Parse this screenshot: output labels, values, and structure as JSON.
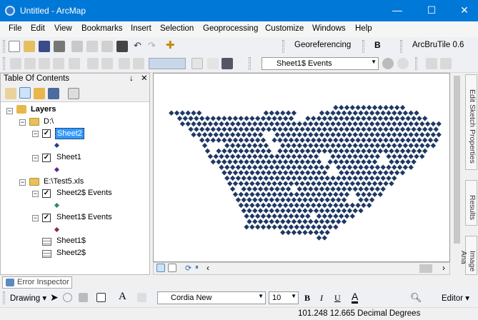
{
  "window": {
    "title": "Untitled - ArcMap",
    "minimize": "—",
    "maximize": "☐",
    "close": "✕"
  },
  "menu": [
    "File",
    "Edit",
    "View",
    "Bookmarks",
    "Insert",
    "Selection",
    "Geoprocessing",
    "Customize",
    "Windows",
    "Help"
  ],
  "toolbar": {
    "georef_label": "Georeferencing",
    "arcbru_label": "ArcBruTile 0.6",
    "layer_combo": "Sheet1$ Events",
    "b_label": "B"
  },
  "toc": {
    "title": "Table Of Contents",
    "pin": "↓",
    "close": "✕",
    "layers_label": "Layers",
    "folder1": "D:\\",
    "sheet2": "Sheet2",
    "sheet1": "Sheet1",
    "folder2": "E:\\Test5.xls",
    "sheet2_events": "Sheet2$ Events",
    "sheet1_events": "Sheet1$ Events",
    "table1": "Sheet1$",
    "table2": "Sheet2$"
  },
  "side_tabs": {
    "edit_sketch": "Edit Sketch Properties",
    "results": "Results",
    "image": "Image Ana"
  },
  "error_inspector": "Error Inspector",
  "drawing": {
    "label": "Drawing",
    "font": "Cordia New",
    "size": "10",
    "bold": "B",
    "italic": "I",
    "underline": "U",
    "editor": "Editor"
  },
  "status": {
    "coords": "101.248  12.665 Decimal Degrees"
  },
  "colors": {
    "points": "#1f3864",
    "sheet2_symbol": "#2a3a8a",
    "sheet1_symbol": "#5a2a8a",
    "sheet2e_symbol": "#2a8a6a",
    "sheet1e_symbol": "#8a2a4a",
    "title_bar": "#0078d7",
    "selection": "#3399ff"
  }
}
